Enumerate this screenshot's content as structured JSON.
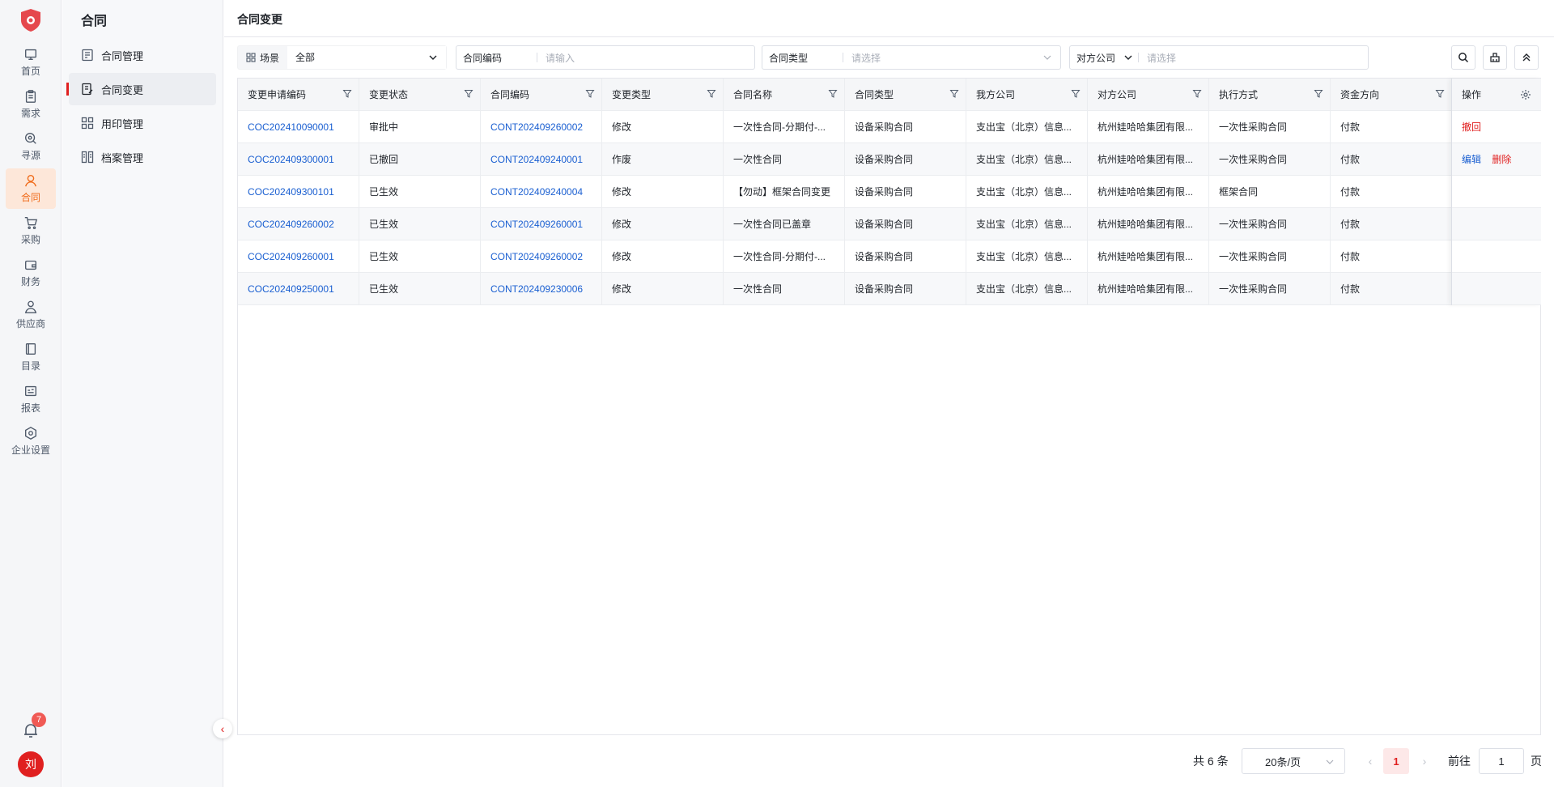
{
  "rail": {
    "items": [
      {
        "label": "首页",
        "icon": "monitor-icon"
      },
      {
        "label": "需求",
        "icon": "clipboard-icon"
      },
      {
        "label": "寻源",
        "icon": "search-icon"
      },
      {
        "label": "合同",
        "icon": "person-icon"
      },
      {
        "label": "采购",
        "icon": "cart-icon"
      },
      {
        "label": "财务",
        "icon": "wallet-icon"
      },
      {
        "label": "供应商",
        "icon": "supplier-icon"
      },
      {
        "label": "目录",
        "icon": "book-icon"
      },
      {
        "label": "报表",
        "icon": "report-icon"
      },
      {
        "label": "企业设置",
        "icon": "settings-icon"
      }
    ],
    "active_index": 3,
    "notification_count": "7",
    "avatar_text": "刘",
    "accent": "#f06b1a"
  },
  "subnav": {
    "title": "合同",
    "items": [
      {
        "label": "合同管理"
      },
      {
        "label": "合同变更"
      },
      {
        "label": "用印管理"
      },
      {
        "label": "档案管理"
      }
    ],
    "active_index": 1
  },
  "page": {
    "title": "合同变更"
  },
  "filters": {
    "scene_label": "场景",
    "scene_value": "全部",
    "code_label": "合同编码",
    "code_placeholder": "请输入",
    "type_label": "合同类型",
    "type_placeholder": "请选择",
    "party_label": "对方公司",
    "party_placeholder": "请选择"
  },
  "table": {
    "headers": [
      "变更申请编码",
      "变更状态",
      "合同编码",
      "变更类型",
      "合同名称",
      "合同类型",
      "我方公司",
      "对方公司",
      "执行方式",
      "资金方向"
    ],
    "op_header": "操作",
    "rows": [
      [
        "COC202410090001",
        "审批中",
        "CONT202409260002",
        "修改",
        "一次性合同-分期付-...",
        "设备采购合同",
        "支出宝（北京）信息...",
        "杭州娃哈哈集团有限...",
        "一次性采购合同",
        "付款"
      ],
      [
        "COC202409300001",
        "已撤回",
        "CONT202409240001",
        "作废",
        "一次性合同",
        "设备采购合同",
        "支出宝（北京）信息...",
        "杭州娃哈哈集团有限...",
        "一次性采购合同",
        "付款"
      ],
      [
        "COC202409300101",
        "已生效",
        "CONT202409240004",
        "修改",
        "【勿动】框架合同变更",
        "设备采购合同",
        "支出宝（北京）信息...",
        "杭州娃哈哈集团有限...",
        "框架合同",
        "付款"
      ],
      [
        "COC202409260002",
        "已生效",
        "CONT202409260001",
        "修改",
        "一次性合同已盖章",
        "设备采购合同",
        "支出宝（北京）信息...",
        "杭州娃哈哈集团有限...",
        "一次性采购合同",
        "付款"
      ],
      [
        "COC202409260001",
        "已生效",
        "CONT202409260002",
        "修改",
        "一次性合同-分期付-...",
        "设备采购合同",
        "支出宝（北京）信息...",
        "杭州娃哈哈集团有限...",
        "一次性采购合同",
        "付款"
      ],
      [
        "COC202409250001",
        "已生效",
        "CONT202409230006",
        "修改",
        "一次性合同",
        "设备采购合同",
        "支出宝（北京）信息...",
        "杭州娃哈哈集团有限...",
        "一次性采购合同",
        "付款"
      ]
    ],
    "row_actions": [
      {
        "withdraw": "撤回"
      },
      {
        "edit": "编辑",
        "delete": "删除"
      },
      {},
      {},
      {},
      {}
    ]
  },
  "pagination": {
    "total_text": "共 6 条",
    "page_size": "20条/页",
    "current_page": "1",
    "goto_label": "前往",
    "goto_value": "1",
    "page_suffix": "页"
  }
}
